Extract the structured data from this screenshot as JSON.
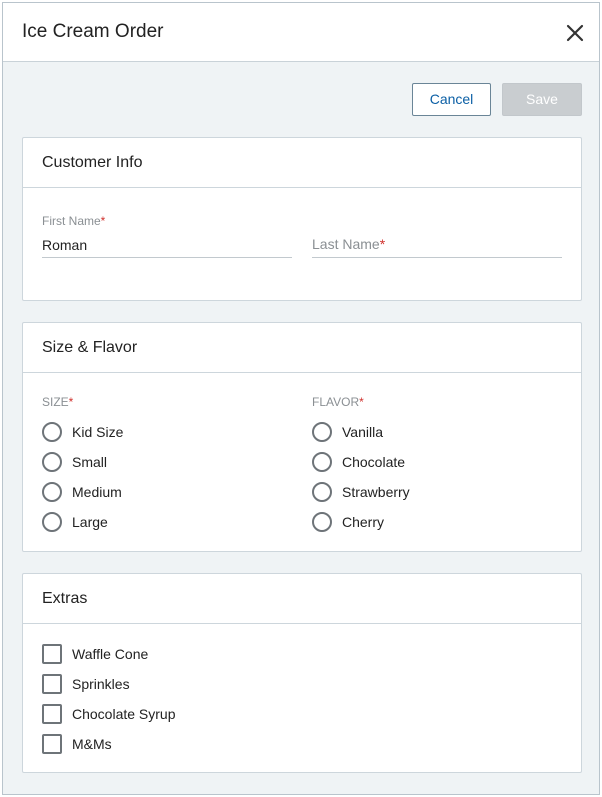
{
  "dialog": {
    "title": "Ice Cream Order",
    "close_icon": "close-icon",
    "cancel_label": "Cancel",
    "save_label": "Save"
  },
  "customer_info": {
    "header": "Customer Info",
    "first_name": {
      "label": "First Name",
      "required_mark": "*",
      "value": "Roman"
    },
    "last_name": {
      "label": "Last Name",
      "required_mark": "*",
      "value": ""
    }
  },
  "size_flavor": {
    "header": "Size & Flavor",
    "size": {
      "label": "SIZE",
      "required_mark": "*",
      "options": [
        "Kid Size",
        "Small",
        "Medium",
        "Large"
      ],
      "selected": null
    },
    "flavor": {
      "label": "FLAVOR",
      "required_mark": "*",
      "options": [
        "Vanilla",
        "Chocolate",
        "Strawberry",
        "Cherry"
      ],
      "selected": null
    }
  },
  "extras": {
    "header": "Extras",
    "options": [
      "Waffle Cone",
      "Sprinkles",
      "Chocolate Syrup",
      "M&Ms"
    ],
    "checked": [
      false,
      false,
      false,
      false
    ]
  },
  "colors": {
    "accent": "#0b5fa5",
    "required": "#d0312d",
    "background": "#eff3f5",
    "disabled_button": "#c9cdd0"
  }
}
